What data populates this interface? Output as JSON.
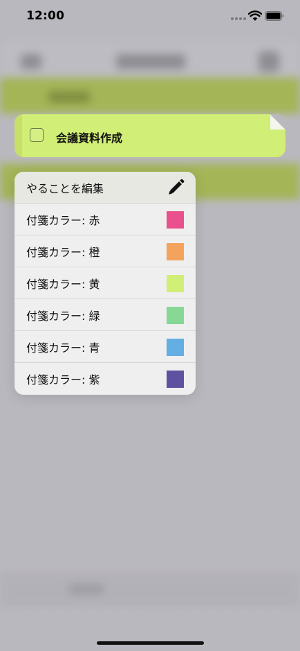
{
  "status_bar": {
    "time": "12:00"
  },
  "task_card": {
    "title": "会議資料作成",
    "color": "#d1ee76"
  },
  "context_menu": {
    "edit_label": "やることを編集",
    "color_options": [
      {
        "label": "付箋カラー: 赤",
        "color": "#e9508c"
      },
      {
        "label": "付箋カラー: 橙",
        "color": "#f3a35c"
      },
      {
        "label": "付箋カラー: 黄",
        "color": "#d1ee76"
      },
      {
        "label": "付箋カラー: 緑",
        "color": "#86d894"
      },
      {
        "label": "付箋カラー: 青",
        "color": "#63aee2"
      },
      {
        "label": "付箋カラー: 紫",
        "color": "#5e52a0"
      }
    ]
  }
}
